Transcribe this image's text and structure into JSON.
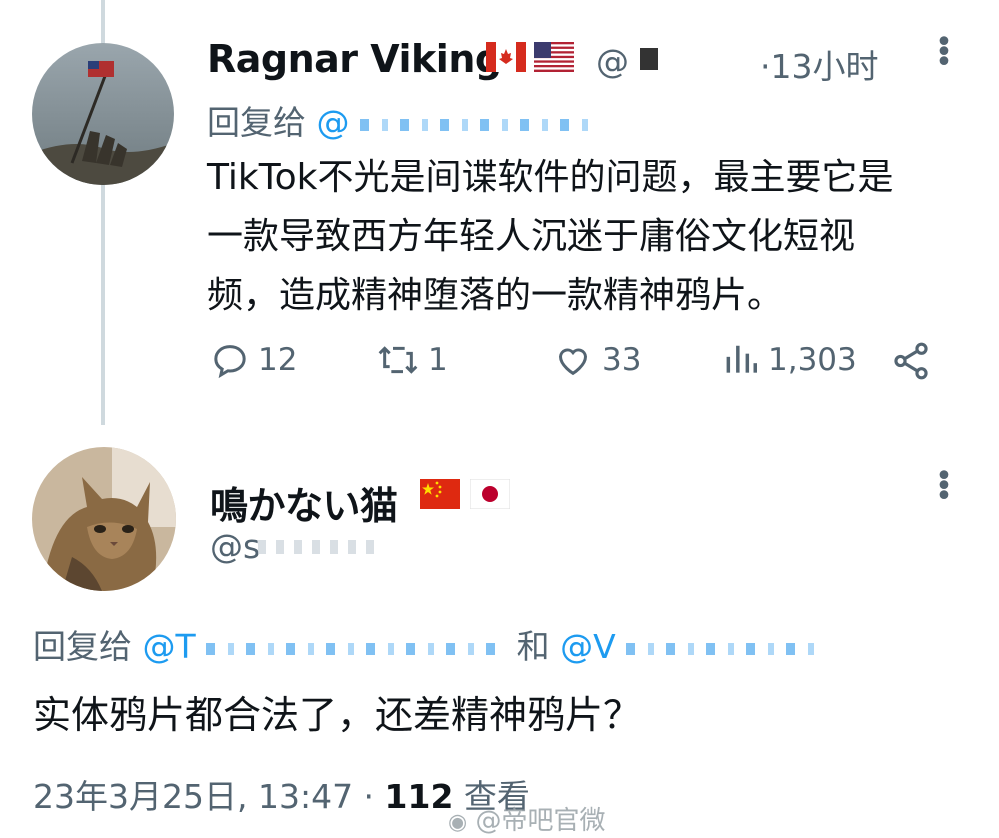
{
  "tweet1": {
    "name": "Ragnar Viking",
    "handle_prefix": "@",
    "time": "·13小时",
    "reply_prefix": "回复给",
    "reply_at": "@",
    "text_lines": [
      "TikTok不光是间谍软件的问题，最主要它是",
      "一款导致西方年轻人沉迷于庸俗文化短视",
      "频，造成精神堕落的一款精神鸦片。"
    ],
    "actions": {
      "replies": "12",
      "retweets": "1",
      "likes": "33",
      "views": "1,303"
    },
    "icons": [
      "flag-canada-icon",
      "flag-usa-icon",
      "more-icon",
      "reply-icon",
      "retweet-icon",
      "like-icon",
      "views-icon",
      "share-icon"
    ]
  },
  "tweet2": {
    "name": "鳴かない猫",
    "handle": "@s",
    "reply_prefix": "回复给",
    "reply_at1": "@T",
    "reply_and": "和",
    "reply_at2": "@V",
    "text": "实体鸦片都合法了，还差精神鸦片？",
    "timestamp": "23年3月25日, 13:47 · ",
    "views_count": "112",
    "views_label": "查看",
    "icons": [
      "flag-china-icon",
      "flag-japan-icon",
      "more-icon"
    ]
  },
  "watermark": "@帝吧官微",
  "colors": {
    "text": "#0f1419",
    "muted": "#536471",
    "link": "#1d9bf0",
    "thread_line": "#cfd9de"
  }
}
